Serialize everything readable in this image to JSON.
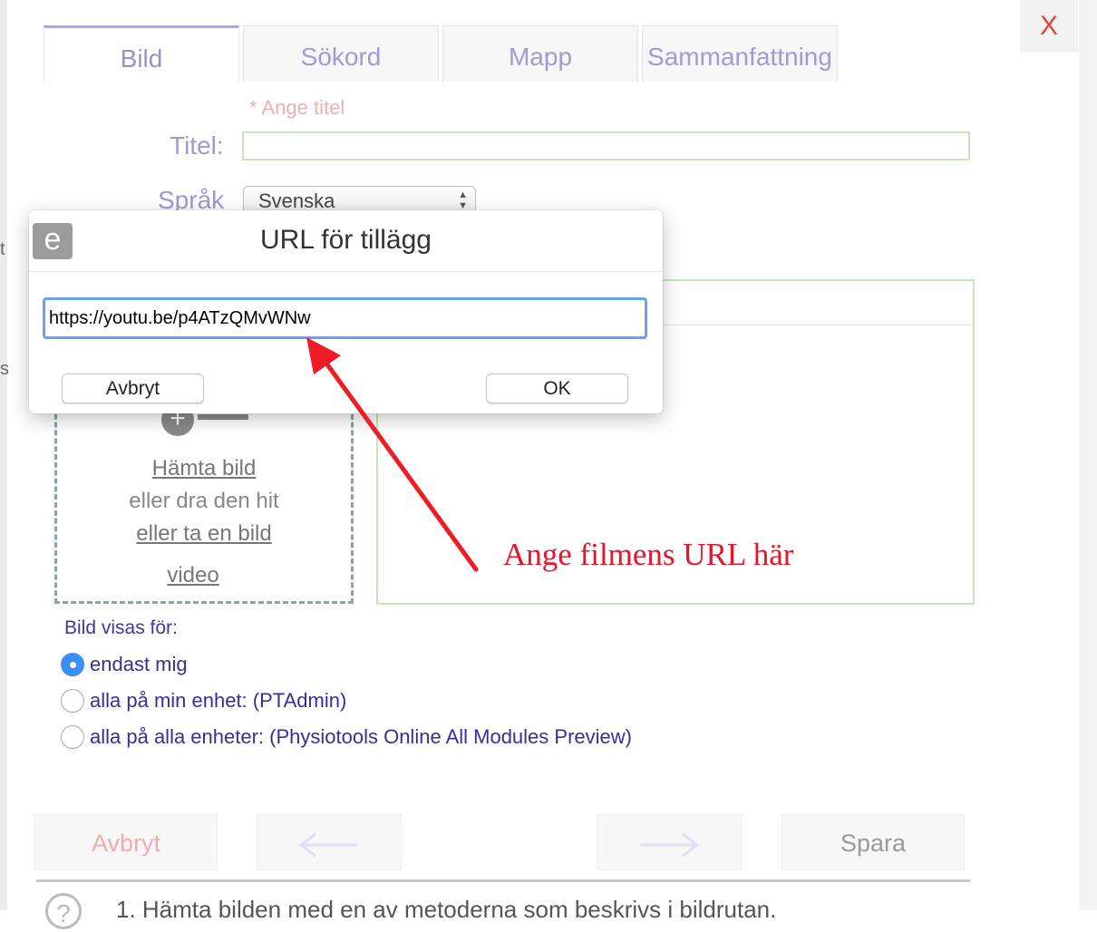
{
  "close_label": "X",
  "edge_chars": [
    "t",
    "s"
  ],
  "tabs": [
    {
      "label": "Bild"
    },
    {
      "label": "Sökord"
    },
    {
      "label": "Mapp"
    },
    {
      "label": "Sammanfattning"
    }
  ],
  "form": {
    "title_hint": "* Ange titel",
    "title_label": "Titel:",
    "title_value": "",
    "language_label": "Språk",
    "language_value": "Svenska"
  },
  "upload": {
    "fetch_link": "Hämta bild",
    "drag_text": "eller dra den hit",
    "take_link": "eller ta en bild",
    "video_link": "video",
    "plus_icon": "+"
  },
  "visibility": {
    "label": "Bild visas för:",
    "options": [
      {
        "label": "endast mig",
        "checked": true
      },
      {
        "label": "alla på min enhet: (PTAdmin)",
        "checked": false
      },
      {
        "label": "alla på alla enheter: (Physiotools Online All Modules Preview)",
        "checked": false
      }
    ]
  },
  "footer": {
    "cancel_label": "Avbryt",
    "prev_icon": "arrow-left-icon",
    "next_icon": "arrow-right-icon",
    "save_label": "Spara",
    "help_icon": "?",
    "instruction_text": "1. Hämta bilden med en av metoderna som beskrivs i bildrutan."
  },
  "dialog": {
    "logo_letter": "e",
    "title": "URL för tillägg",
    "url_value": "https://youtu.be/p4ATzQMvWNw",
    "cancel_label": "Avbryt",
    "ok_label": "OK"
  },
  "annotation": {
    "text": "Ange filmens URL här",
    "color": "#e8142a"
  },
  "colors": {
    "tab_text": "#a49ad0",
    "label_text": "#a497d6",
    "hint_text": "#eeaeb3",
    "radio_text": "#3a2d9a",
    "focus_blue": "#6aa2f1",
    "close_red": "#e0443a"
  }
}
